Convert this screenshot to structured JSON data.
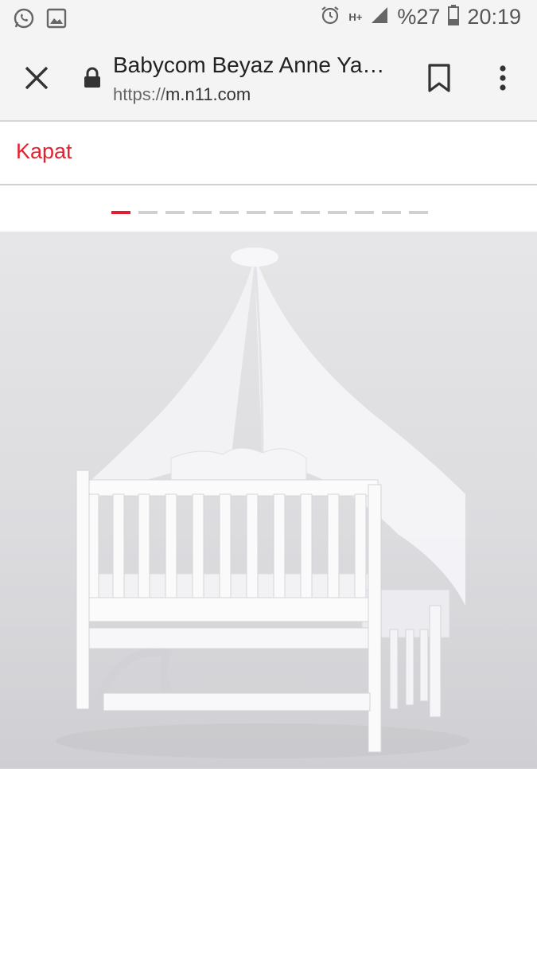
{
  "status_bar": {
    "time": "20:19",
    "battery": "%27",
    "network": "H+",
    "left_icons": [
      "whatsapp-icon",
      "image-icon"
    ],
    "right_icons": [
      "alarm-icon",
      "signal-icon",
      "battery-icon"
    ]
  },
  "browser": {
    "title": "Babycom Beyaz Anne Ya…",
    "url_protocol": "https://",
    "url_host": "m.n11.com",
    "icons": [
      "close-icon",
      "lock-icon",
      "bookmark-icon",
      "more-vert-icon"
    ]
  },
  "gallery": {
    "close_label": "Kapat",
    "total_images": 12,
    "active_index": 1,
    "image_description_icon": "baby-crib-with-canopy-image"
  },
  "colors": {
    "accent": "#e5202e",
    "background": "#ffffff",
    "toolbar": "#f4f4f4"
  }
}
